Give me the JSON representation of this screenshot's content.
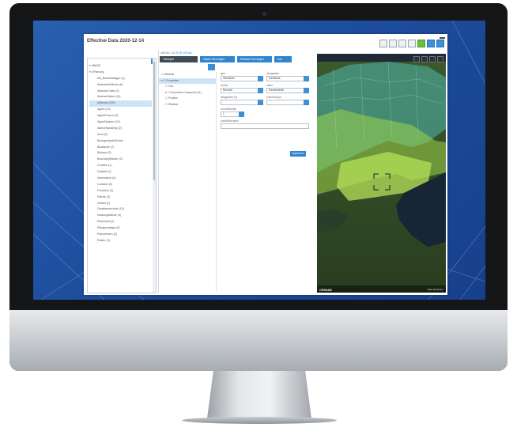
{
  "app": {
    "title": "Effective Data 2020-12-14",
    "breadcrumb_root": "xBASE",
    "breadcrumb_active": "ACTIVE DETAIL"
  },
  "tabs": [
    {
      "label": "Teilobjekt",
      "style": "dark"
    },
    {
      "label": "Objekt hinzufügen",
      "style": "blue"
    },
    {
      "label": "Relation hinzufügen",
      "style": "blue"
    },
    {
      "label": "Info",
      "style": "blue"
    }
  ],
  "tree": {
    "items": [
      {
        "label": "▾ xBASE",
        "selected": false
      },
      {
        "label": "▾ XPlanung",
        "selected": false
      },
      {
        "label": "AA_BaseDatatype (1)",
        "selected": false
      },
      {
        "label": "AbstractAttribute (6)",
        "selected": false
      },
      {
        "label": "AbstractClass (2)",
        "selected": false
      },
      {
        "label": "AbstractValue (10)",
        "selected": false
      },
      {
        "label": "Address (100)",
        "selected": true
      },
      {
        "label": "Agent (10)",
        "selected": false
      },
      {
        "label": "AgentPerson (3)",
        "selected": false
      },
      {
        "label": "AgentSystem (10)",
        "selected": false
      },
      {
        "label": "AuthorityActivity (2)",
        "selected": false
      },
      {
        "label": "Area (2)",
        "selected": false
      },
      {
        "label": "BezugsobjektSchutz",
        "selected": false
      },
      {
        "label": "Bauflache (7)",
        "selected": false
      },
      {
        "label": "Biotope (3)",
        "selected": false
      },
      {
        "label": "BoundaryMarker (2)",
        "selected": false
      },
      {
        "label": "Codelist (1)",
        "selected": false
      },
      {
        "label": "Dataset (1)",
        "selected": false
      },
      {
        "label": "Information (4)",
        "selected": false
      },
      {
        "label": "Location (2)",
        "selected": false
      },
      {
        "label": "Flurstück (3)",
        "selected": false
      },
      {
        "label": "Fläche (2)",
        "selected": false
      },
      {
        "label": "Gebiet (1)",
        "selected": false
      },
      {
        "label": "Gewässerschutz (10)",
        "selected": false
      },
      {
        "label": "Nutzungsfläche (3)",
        "selected": false
      },
      {
        "label": "Planinhalt (2)",
        "selected": false
      },
      {
        "label": "Plangrundlage (5)",
        "selected": false
      },
      {
        "label": "Planzeichen (2)",
        "selected": false
      },
      {
        "label": "Raster (2)",
        "selected": false
      }
    ]
  },
  "side_tree": {
    "items": [
      {
        "label": "☐ Attribute",
        "selected": false
      },
      {
        "label": "▾ ☐ Properties",
        "selected": true
      },
      {
        "label": "☐ Geo",
        "selected": false
      },
      {
        "label": "▸ ☐ Geometric Component (1)",
        "selected": false
      },
      {
        "label": "☐ Position",
        "selected": false
      },
      {
        "label": "☐ Relation",
        "selected": false
      }
    ]
  },
  "form": {
    "type_label": "type",
    "type_value": "Gemeinde",
    "designation_label": "designation",
    "designation_value": "Gemeinde",
    "locator_label": "locator",
    "locator_value": "Nummer",
    "name_label": "name",
    "name_value": "Gemeindeteil",
    "designation2_label": "designation (2)",
    "designation2_value": "",
    "codelist_label": "codeListType",
    "codelist_value": "",
    "levelname_label": "LevelOfAdmin",
    "levelname_value": "1",
    "description_label": "postalDescriptor",
    "ok_label": "Speichern"
  },
  "map": {
    "logo": "CESIUM",
    "credit": "Data attribution"
  }
}
